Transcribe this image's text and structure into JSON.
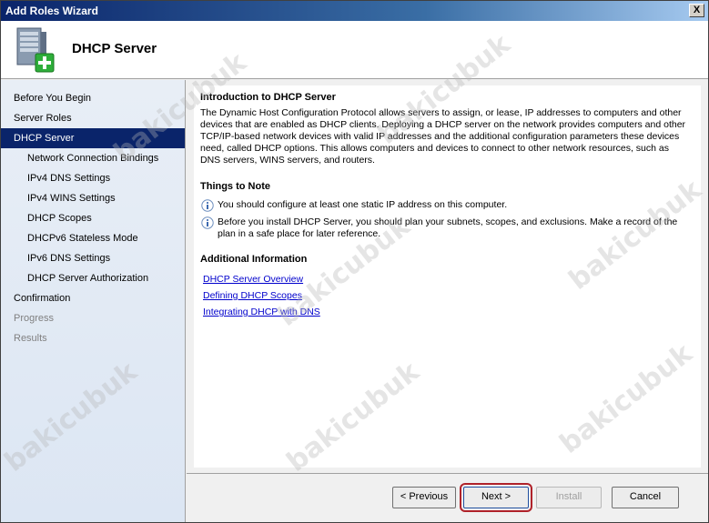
{
  "window": {
    "title": "Add Roles Wizard",
    "close_label": "X"
  },
  "header": {
    "title": "DHCP Server",
    "icon": "server-add-icon"
  },
  "sidebar": {
    "items": [
      {
        "label": "Before You Begin",
        "state": "normal",
        "level": 0
      },
      {
        "label": "Server Roles",
        "state": "normal",
        "level": 0
      },
      {
        "label": "DHCP Server",
        "state": "active",
        "level": 0
      },
      {
        "label": "Network Connection Bindings",
        "state": "normal",
        "level": 1
      },
      {
        "label": "IPv4 DNS Settings",
        "state": "normal",
        "level": 1
      },
      {
        "label": "IPv4 WINS Settings",
        "state": "normal",
        "level": 1
      },
      {
        "label": "DHCP Scopes",
        "state": "normal",
        "level": 1
      },
      {
        "label": "DHCPv6 Stateless Mode",
        "state": "normal",
        "level": 1
      },
      {
        "label": "IPv6 DNS Settings",
        "state": "normal",
        "level": 1
      },
      {
        "label": "DHCP Server Authorization",
        "state": "normal",
        "level": 1
      },
      {
        "label": "Confirmation",
        "state": "normal",
        "level": 0
      },
      {
        "label": "Progress",
        "state": "disabled",
        "level": 0
      },
      {
        "label": "Results",
        "state": "disabled",
        "level": 0
      }
    ]
  },
  "content": {
    "intro_title": "Introduction to DHCP Server",
    "intro_text": "The Dynamic Host Configuration Protocol allows servers to assign, or lease, IP addresses to computers and other devices that are enabled as DHCP clients. Deploying a DHCP server on the network provides computers and other TCP/IP-based network devices with valid IP addresses and the additional configuration parameters these devices need, called DHCP options. This allows computers and devices to connect to other network resources, such as DNS servers, WINS servers, and routers.",
    "notes_title": "Things to Note",
    "notes": [
      "You should configure at least one static IP address on this computer.",
      "Before you install DHCP Server, you should plan your subnets, scopes, and exclusions. Make a record of the plan in a safe place for later reference."
    ],
    "additional_title": "Additional Information",
    "links": [
      "DHCP Server Overview",
      "Defining DHCP Scopes",
      "Integrating DHCP with DNS"
    ]
  },
  "footer": {
    "previous_label": "< Previous",
    "next_label": "Next >",
    "install_label": "Install",
    "cancel_label": "Cancel"
  },
  "watermark": "bakicubuk",
  "colors": {
    "selection": "#0a246a",
    "link": "#0000cc",
    "highlight_border": "#b0222a"
  }
}
